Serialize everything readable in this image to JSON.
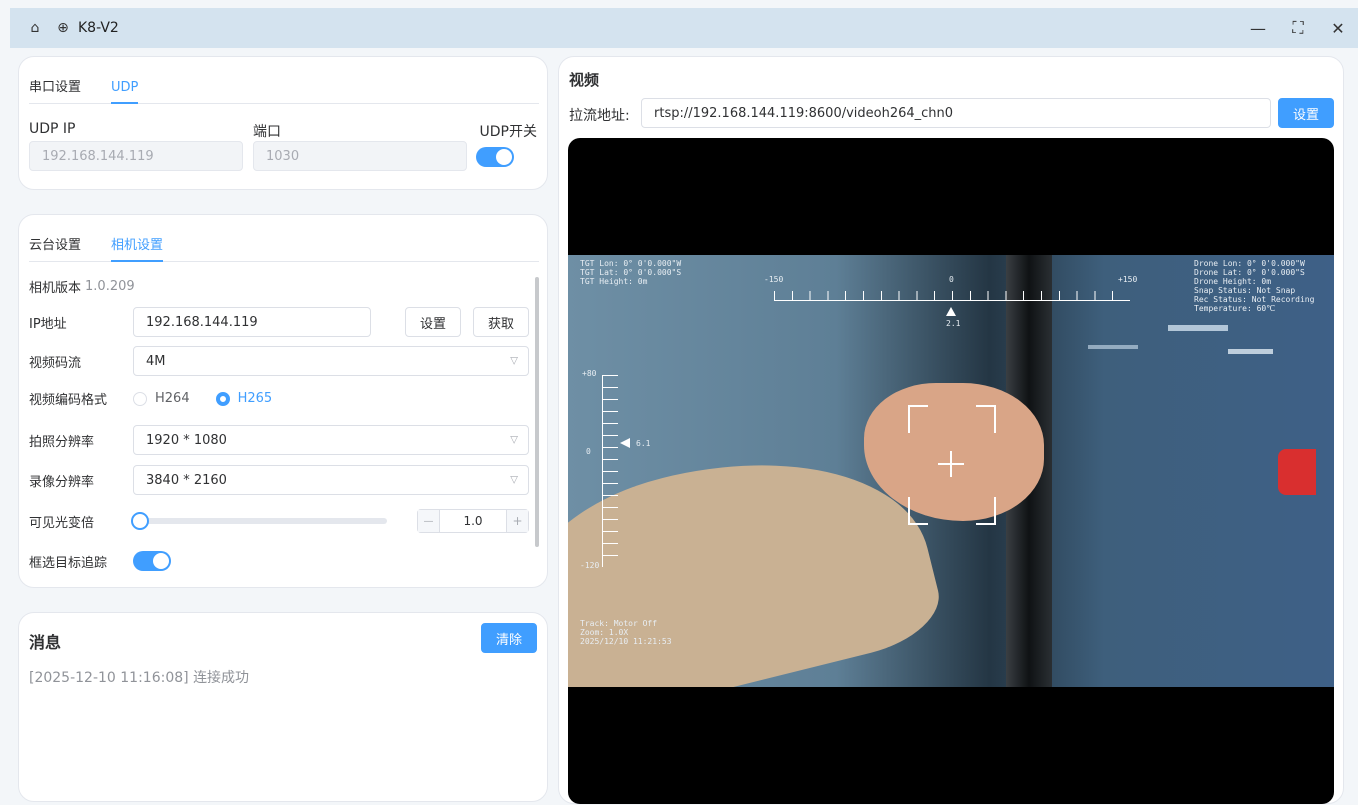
{
  "window": {
    "title": "K8-V2",
    "home_icon": "home-icon",
    "globe_icon": "globe-icon",
    "minimize": "—",
    "maximize": "⛶",
    "close": "✕"
  },
  "conn": {
    "tabs": [
      "串口设置",
      "UDP"
    ],
    "active_tab": 1,
    "ip_label": "UDP IP",
    "ip_value": "192.168.144.119",
    "port_label": "端口",
    "port_value": "1030",
    "switch_label": "UDP开关",
    "switch_on": true
  },
  "settings": {
    "tabs": [
      "云台设置",
      "相机设置"
    ],
    "active_tab": 1,
    "version_label": "相机版本",
    "version_value": "1.0.209",
    "ip_label": "IP地址",
    "ip_value": "192.168.144.119",
    "set_btn": "设置",
    "get_btn": "获取",
    "stream_label": "视频码流",
    "stream_value": "4M",
    "codec_label": "视频编码格式",
    "codec_options": [
      "H264",
      "H265"
    ],
    "codec_selected": "H265",
    "photo_res_label": "拍照分辨率",
    "photo_res_value": "1920 * 1080",
    "record_res_label": "录像分辨率",
    "record_res_value": "3840 * 2160",
    "zoom_label": "可见光变倍",
    "zoom_value": "1.0",
    "zoom_minus": "—",
    "zoom_plus": "+",
    "track_label": "框选目标追踪",
    "track_on": true
  },
  "messages": {
    "title": "消息",
    "clear_btn": "清除",
    "items": [
      "[2025-12-10 11:16:08] 连接成功"
    ]
  },
  "video": {
    "title": "视频",
    "url_label": "拉流地址:",
    "url_value": "rtsp://192.168.144.119:8600/videoh264_chn0",
    "set_btn": "设置",
    "osd": {
      "tgt_left": "TGT Lon: 0° 0'0.000\"W\nTGT Lat: 0° 0'0.000\"S\nTGT Height: 0m",
      "drone_right": "Drone Lon: 0° 0'0.000\"W\nDrone Lat: 0° 0'0.000\"S\nDrone Height: 0m\nSnap Status: Not Snap\nRec Status: Not Recording\nTemperature: 60℃",
      "bottom_left": "Track: Motor Off\nZoom: 1.0X\n2025/12/10 11:21:53",
      "yaw_left": "-150",
      "yaw_center": "0",
      "yaw_right": "+150",
      "yaw_value": "2.1",
      "pitch_top": "+80",
      "pitch_zero": "0",
      "pitch_bottom": "-120",
      "pitch_value": "6.1"
    }
  }
}
